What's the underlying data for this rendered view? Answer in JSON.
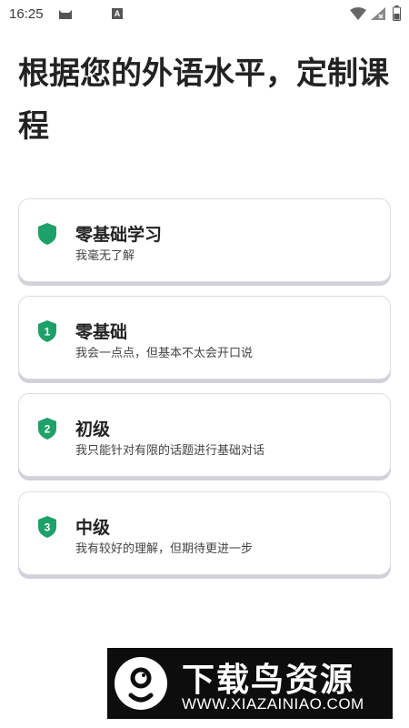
{
  "status_bar": {
    "time": "16:25",
    "icons": [
      "cat-icon",
      "a-notification-icon",
      "wifi-icon",
      "signal-icon",
      "battery-icon"
    ],
    "a_label": "A"
  },
  "page": {
    "title": "根据您的外语水平，定制课程"
  },
  "colors": {
    "badge_green": "#1ea06a",
    "card_border": "#dcdde2",
    "card_shadow": "#d0d2d8"
  },
  "levels": [
    {
      "badge": "",
      "title": "零基础学习",
      "desc": "我毫无了解"
    },
    {
      "badge": "1",
      "title": "零基础",
      "desc": "我会一点点，但基本不太会开口说"
    },
    {
      "badge": "2",
      "title": "初级",
      "desc": "我只能针对有限的话题进行基础对话"
    },
    {
      "badge": "3",
      "title": "中级",
      "desc": "我有较好的理解，但期待更进一步"
    }
  ],
  "watermark": {
    "title": "下载鸟资源",
    "url": "WWW.XIAZAINIAO.COM"
  }
}
